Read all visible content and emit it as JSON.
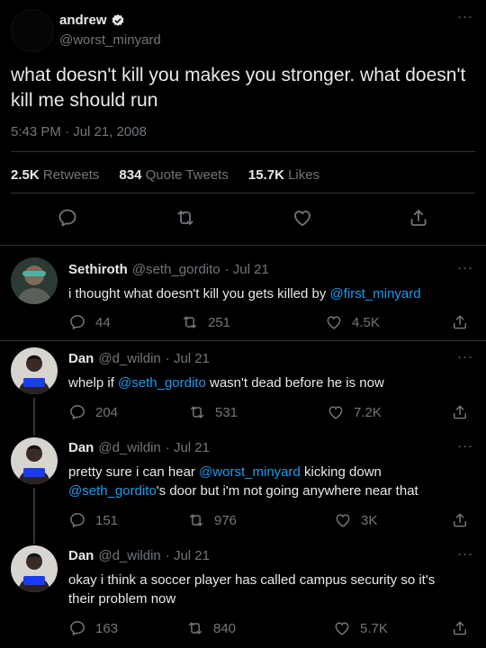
{
  "main": {
    "author": {
      "name": "andrew",
      "handle": "@worst_minyard",
      "verified_icon": "verified-badge-icon",
      "avatar_color": "#050505"
    },
    "more_label": "···",
    "text": "what doesn't kill you makes you stronger. what doesn't kill me should run",
    "time": "5:43 PM · Jul 21, 2008",
    "stats": {
      "retweets_count": "2.5K",
      "retweets_label": "Retweets",
      "quotes_count": "834",
      "quotes_label": "Quote Tweets",
      "likes_count": "15.7K",
      "likes_label": "Likes"
    },
    "actions": [
      "reply-icon",
      "retweet-icon",
      "like-icon",
      "share-icon"
    ]
  },
  "replies": [
    {
      "name": "Sethiroth",
      "handle": "@seth_gordito",
      "date": "· Jul 21",
      "text_before": "i thought what doesn't kill you gets killed by ",
      "mention": "@first_minyard",
      "replies_count": "44",
      "retweets_count": "251",
      "likes_count": "4.5K"
    },
    {
      "name": "Dan",
      "handle": "@d_wildin",
      "date": "· Jul 21",
      "text_before": "whelp if ",
      "mention": "@seth_gordito",
      "text_after": " wasn't dead before he is now",
      "replies_count": "204",
      "retweets_count": "531",
      "likes_count": "7.2K"
    },
    {
      "name": "Dan",
      "handle": "@d_wildin",
      "date": "· Jul 21",
      "text_line1_before": "pretty sure i can hear ",
      "mention1": "@worst_minyard",
      "text_line1_after": " kicking down",
      "mention2": "@seth_gordito",
      "text_line2_after": "'s door but i'm not going anywhere near that",
      "replies_count": "151",
      "retweets_count": "976",
      "likes_count": "3K"
    },
    {
      "name": "Dan",
      "handle": "@d_wildin",
      "date": "· Jul 21",
      "text": "okay i think a soccer player has called campus security so it's their problem now",
      "replies_count": "163",
      "retweets_count": "840",
      "likes_count": "5.7K"
    }
  ],
  "colors": {
    "background": "#000000",
    "text": "#e7e9ea",
    "muted": "#71767b",
    "link": "#1d9bf0",
    "divider": "#2f3336"
  }
}
